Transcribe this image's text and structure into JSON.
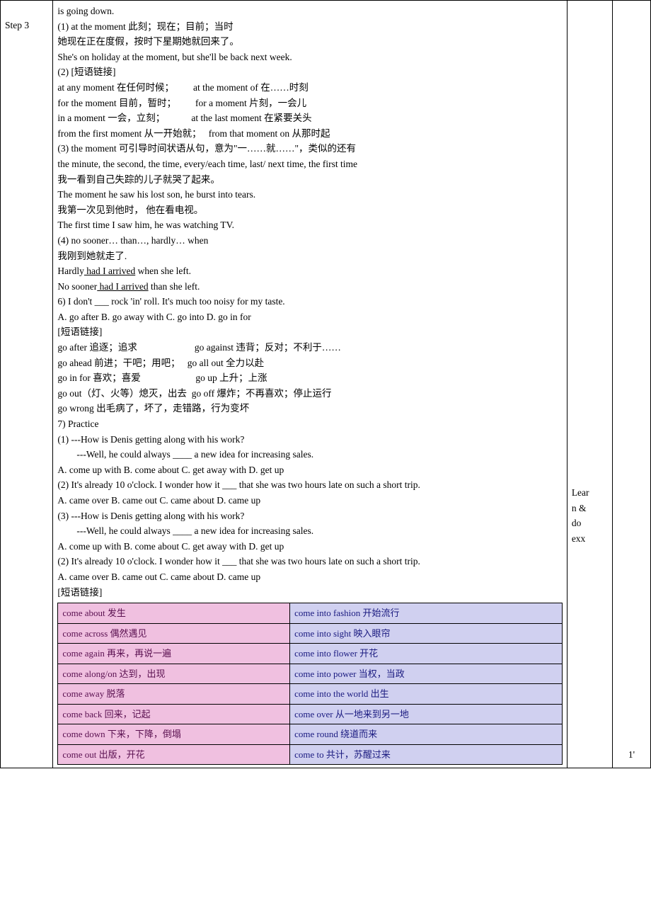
{
  "step_label": "Step 3",
  "lines": {
    "l00": "is going down.",
    "l01": "(1) at the moment  此刻；现在；目前；当时",
    "l02": "她现在正在度假，按时下星期她就回来了。",
    "l03": "She's on holiday at the moment, but she'll be back next week.",
    "l04": "(2) [短语链接]",
    "l05a": "at any moment 在任何时候；",
    "l05b": "at the moment of 在……时刻",
    "l06a": "for the moment 目前，暂时；",
    "l06b": "for a moment 片刻，一会儿",
    "l07a": "in a moment 一会，立刻；",
    "l07b": "at the last moment 在紧要关头",
    "l08a": "from the first moment 从一开始就；",
    "l08b": "from that moment on 从那时起",
    "l09": "(3) the moment 可引导时间状语从句，意为\"一……就……\"，类似的还有",
    "l10": " the minute, the second, the time, every/each time, last/ next time, the first time",
    "l11": "我一看到自己失踪的儿子就哭了起来。",
    "l12": "The moment he saw his lost son, he burst into tears.",
    "l13": "我第一次见到他时，  他在看电视。",
    "l14": "The first time I saw him, he was watching TV.",
    "l15": "(4) no sooner… than…, hardly… when",
    "l16": "我刚到她就走了.",
    "l17a": "Hardly",
    "l17b": " had I arrived",
    "l17c": " when she left.",
    "l18a": "No sooner",
    "l18b": " had I arrived",
    "l18c": " than she left.",
    "l19": "6) I don't ___ rock 'in' roll. It's much too noisy for my taste.",
    "l20": "A. go after  B. go away with  C. go into  D. go in for",
    "l21": "[短语链接]",
    "l22a": "go after 追逐；追求",
    "l22b": "go against 违背；反对；不利于……",
    "l23a": "go ahead 前进；干吧；用吧；",
    "l23b": "go all out 全力以赴",
    "l24a": "go in for 喜欢；喜爱",
    "l24b": "go up 上升；上涨",
    "l25a": "go out（灯、火等）熄灭，出去",
    "l25b": "go off 爆炸；不再喜欢；停止运行",
    "l26": "go wrong 出毛病了，坏了，走错路，行为变坏",
    "l27": "7) Practice",
    "l28": "(1) ---How is Denis getting along with his work?",
    "l29": "---Well, he could always ____ a new idea for increasing sales.",
    "l30": "A. come up with    B. come about  C. get away with   D. get up",
    "l31": "(2) It's already 10 o'clock. I wonder how it ___ that she was two hours late on such a short trip.",
    "l32": "A. came over    B. came out    C. came about   D. came up",
    "l33": "(3) ---How is Denis getting along with his work?",
    "l34": "---Well, he could always ____ a new idea for increasing sales.",
    "l35": "A. come up with    B. come about  C. get away with   D. get up",
    "l36": "(2) It's already 10 o'clock. I wonder how it ___ that she was two hours late on such a short trip.",
    "l37": "A. came over    B. came out    C. came about   D. came up",
    "l38": "[短语链接]"
  },
  "inner": [
    [
      "come about 发生",
      "come into fashion 开始流行"
    ],
    [
      "come across 偶然遇见",
      "come into sight 映入眼帘"
    ],
    [
      "come again 再来，再说一遍",
      "come into flower 开花"
    ],
    [
      "come along/on 达到，出现",
      "come into power 当权，当政"
    ],
    [
      "come away 脱落",
      "come into the world 出生"
    ],
    [
      "come back 回来，记起",
      "come over 从一地来到另一地"
    ],
    [
      "come down 下来，下降，倒塌",
      "come round 绕道而来"
    ],
    [
      "come out 出版，开花",
      "come to 共计，苏醒过来"
    ]
  ],
  "notes": "Lear\nn &\ndo\nexx",
  "time": "1'"
}
